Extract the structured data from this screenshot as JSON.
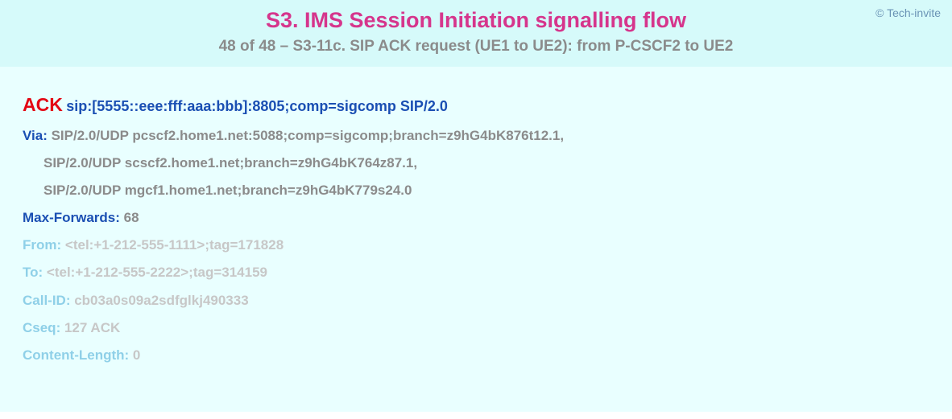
{
  "header": {
    "copyright": "© Tech-invite",
    "title": "S3. IMS Session Initiation signalling flow",
    "subtitle": "48 of 48 – S3-11c. SIP ACK request (UE1 to UE2): from P-CSCF2 to UE2"
  },
  "request": {
    "method": "ACK",
    "uri": "sip:[5555::eee:fff:aaa:bbb]:8805;comp=sigcomp SIP/2.0"
  },
  "headers": {
    "via": {
      "label": "Via:",
      "line1": " SIP/2.0/UDP pcscf2.home1.net:5088;comp=sigcomp;branch=z9hG4bK876t12.1,",
      "line2": "SIP/2.0/UDP scscf2.home1.net;branch=z9hG4bK764z87.1,",
      "line3": "SIP/2.0/UDP mgcf1.home1.net;branch=z9hG4bK779s24.0"
    },
    "maxForwards": {
      "label": "Max-Forwards:",
      "value": " 68"
    },
    "from": {
      "label": "From:",
      "value": " <tel:+1-212-555-1111>;tag=171828"
    },
    "to": {
      "label": "To:",
      "value": " <tel:+1-212-555-2222>;tag=314159"
    },
    "callId": {
      "label": "Call-ID:",
      "value": " cb03a0s09a2sdfglkj490333"
    },
    "cseq": {
      "label": "Cseq:",
      "value": " 127 ACK"
    },
    "contentLength": {
      "label": "Content-Length:",
      "value": " 0"
    }
  }
}
